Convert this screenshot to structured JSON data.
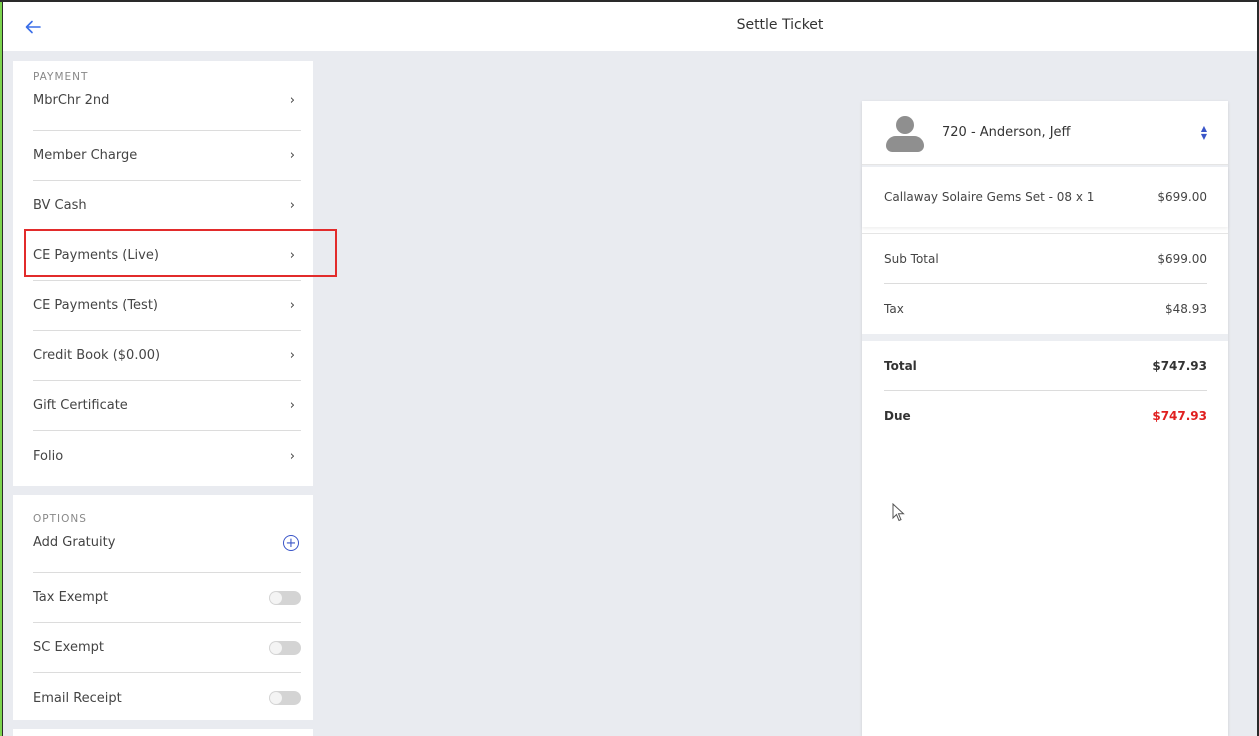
{
  "header": {
    "title": "Settle Ticket",
    "back_icon": "arrow-left-icon"
  },
  "payment": {
    "section_label": "PAYMENT",
    "items": [
      {
        "label": "MbrChr 2nd"
      },
      {
        "label": "Member Charge"
      },
      {
        "label": "BV Cash"
      },
      {
        "label": "CE Payments (Live)",
        "highlighted": true
      },
      {
        "label": "CE Payments (Test)"
      },
      {
        "label": "Credit Book ($0.00)"
      },
      {
        "label": "Gift Certificate"
      },
      {
        "label": "Folio"
      }
    ],
    "chevron": "›"
  },
  "options": {
    "section_label": "OPTIONS",
    "add_gratuity": "Add Gratuity",
    "tax_exempt": "Tax Exempt",
    "sc_exempt": "SC Exempt",
    "email_receipt": "Email Receipt",
    "toggles": {
      "tax_exempt": false,
      "sc_exempt": false,
      "email_receipt": false
    }
  },
  "ticket": {
    "member": "720 - Anderson, Jeff",
    "item": {
      "description": "Callaway Solaire Gems Set - 08 x 1",
      "price": "$699.00"
    },
    "sub_total_label": "Sub Total",
    "sub_total": "$699.00",
    "tax_label": "Tax",
    "tax": "$48.93",
    "total_label": "Total",
    "total": "$747.93",
    "due_label": "Due",
    "due": "$747.93"
  },
  "colors": {
    "accent": "#3a55c8",
    "highlight_border": "#e22b2b",
    "due": "#e02020",
    "background": "#e9ebf0"
  }
}
